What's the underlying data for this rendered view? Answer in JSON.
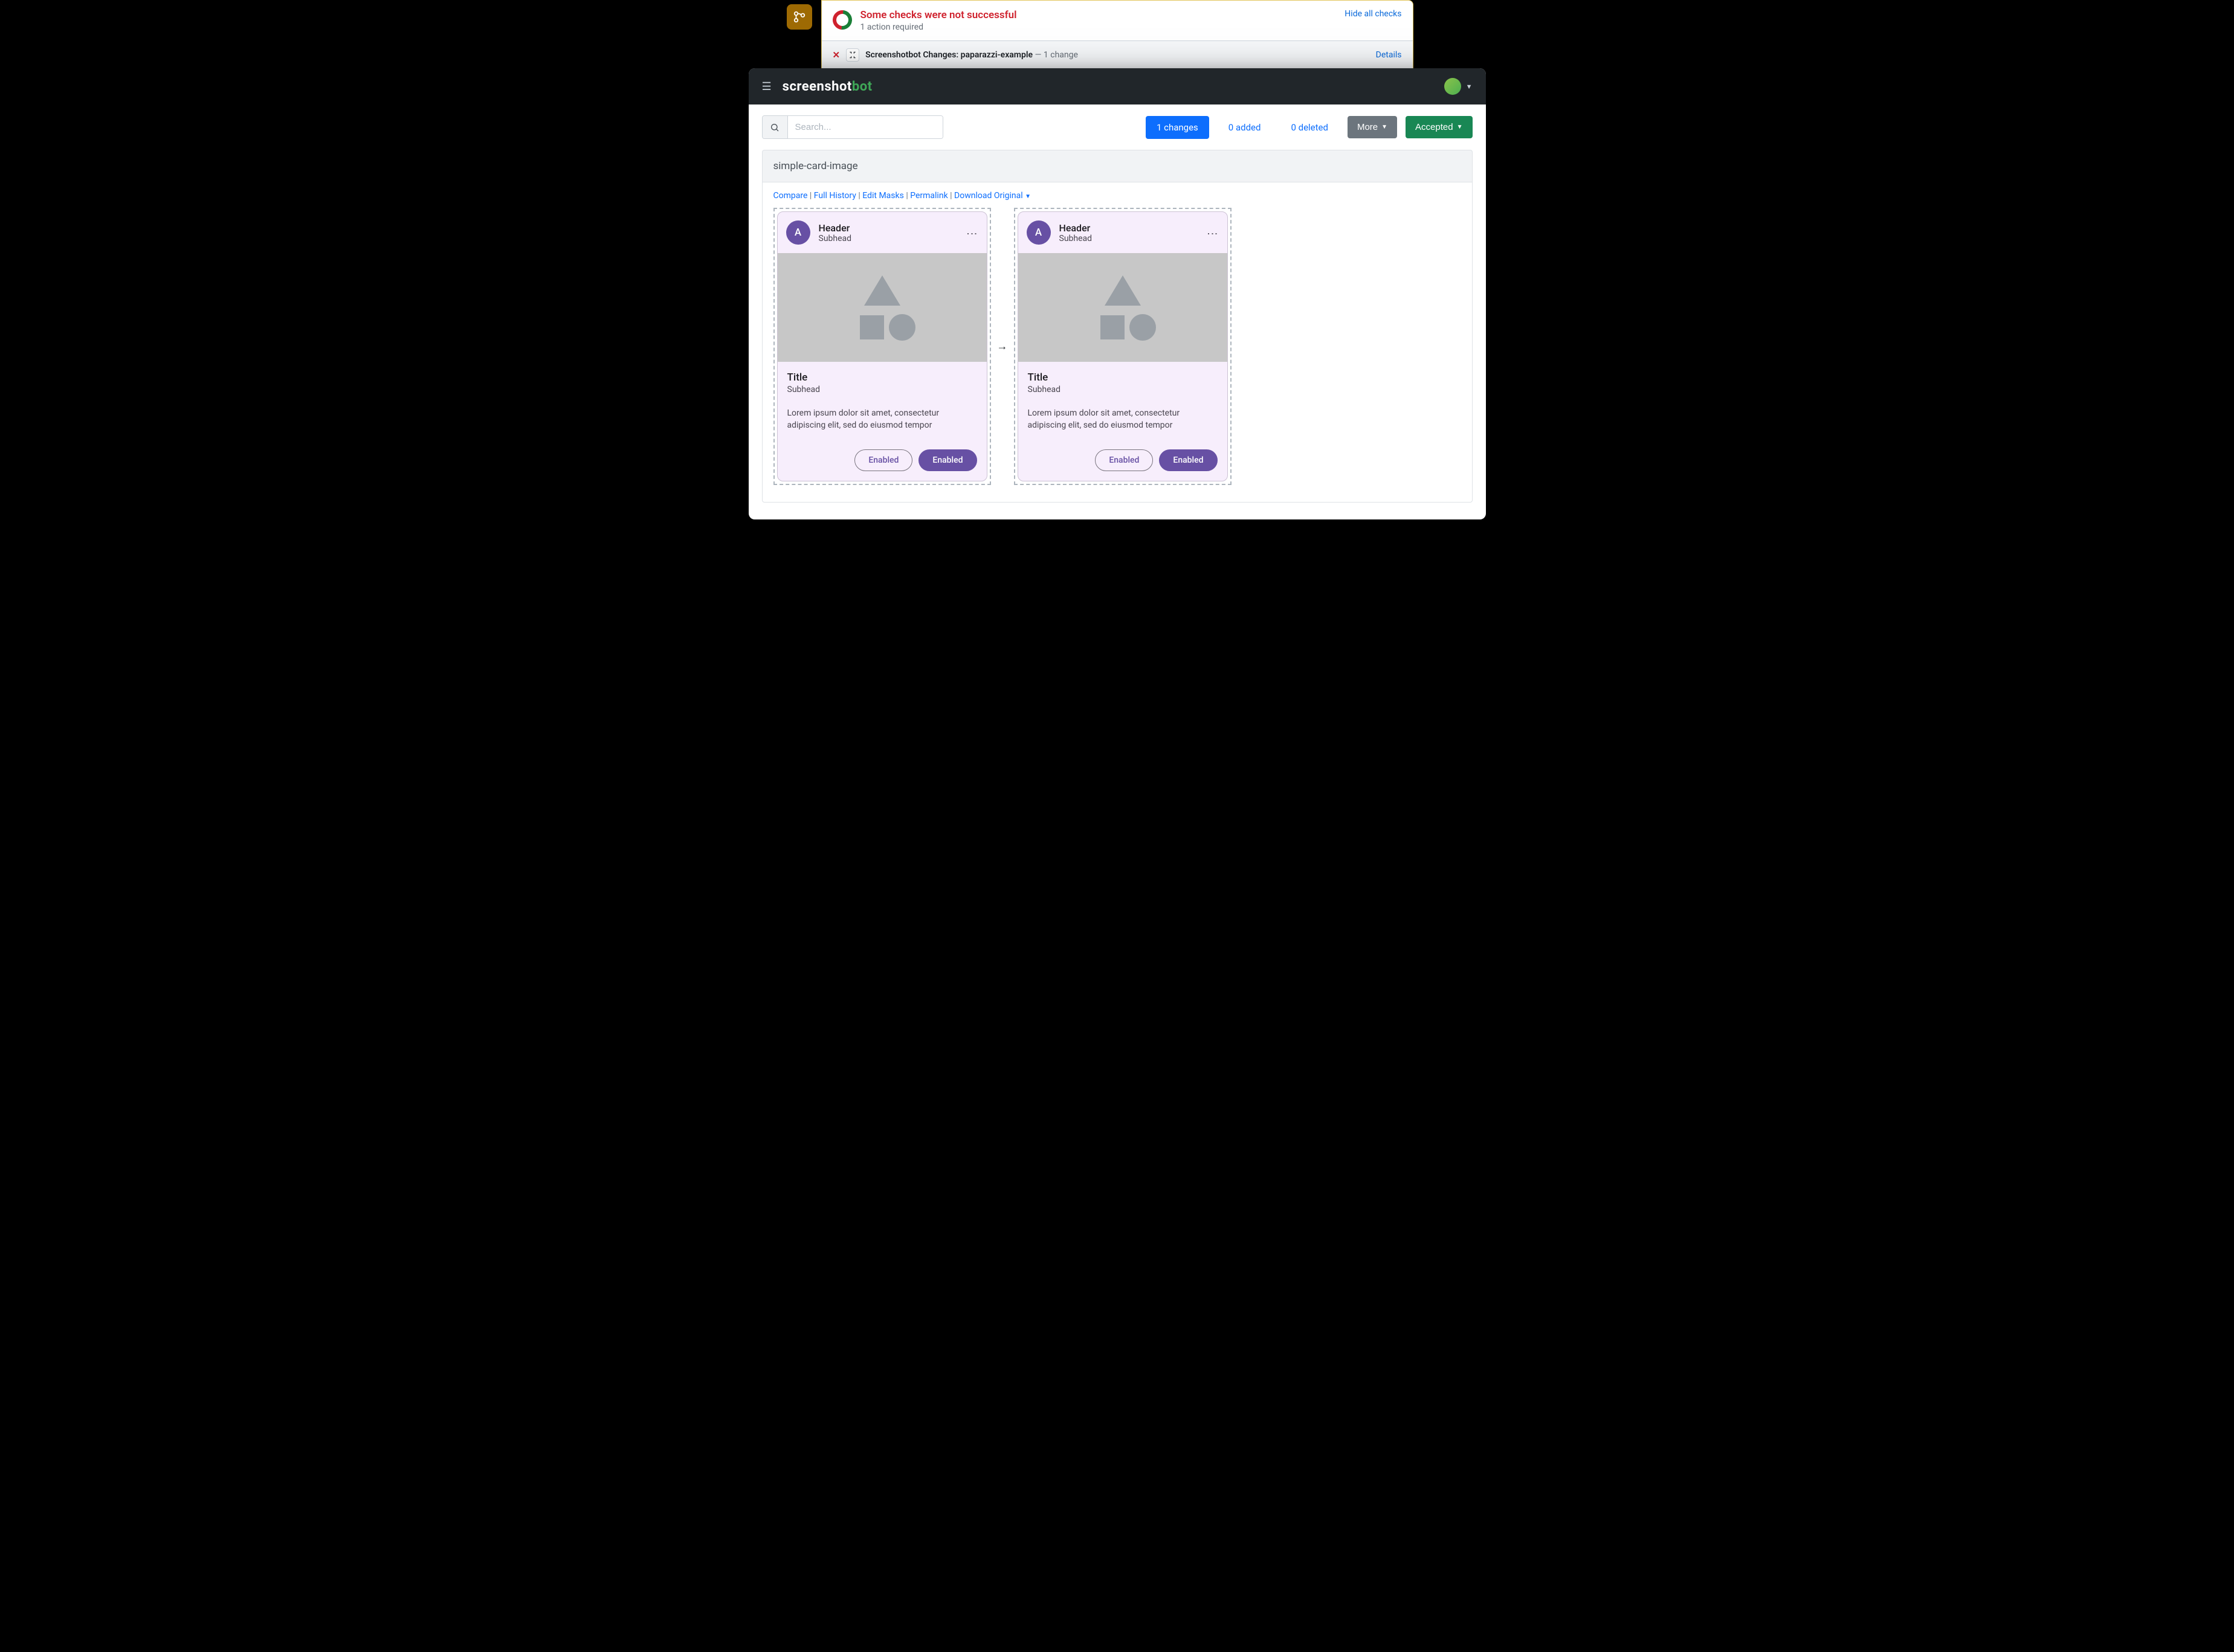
{
  "github": {
    "title": "Some checks were not successful",
    "subtitle": "1 action required",
    "hide": "Hide all checks",
    "check_name": "Screenshotbot Changes: paparazzi-example",
    "check_suffix": " — 1 change",
    "details": "Details"
  },
  "brand": {
    "a": "screenshot",
    "b": "bot"
  },
  "search": {
    "placeholder": "Search..."
  },
  "counts": {
    "changes": "1 changes",
    "added": "0 added",
    "deleted": "0 deleted"
  },
  "buttons": {
    "more": "More",
    "accepted": "Accepted"
  },
  "test": {
    "name": "simple-card-image",
    "links": {
      "compare": "Compare",
      "history": "Full History",
      "masks": "Edit Masks",
      "permalink": "Permalink",
      "download": "Download Original"
    }
  },
  "card": {
    "avatar_letter": "A",
    "header": "Header",
    "subhead": "Subhead",
    "title": "Title",
    "title_sub": "Subhead",
    "body": "Lorem ipsum dolor sit amet, consectetur adipiscing elit, sed do eiusmod tempor",
    "btn_outline": "Enabled",
    "btn_fill": "Enabled"
  }
}
